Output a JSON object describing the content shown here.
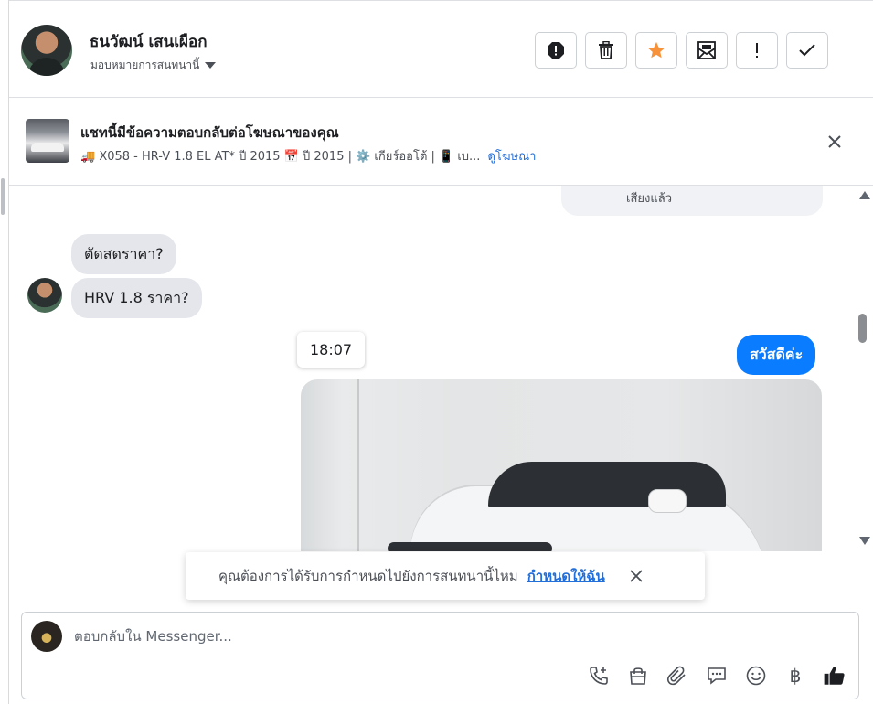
{
  "header": {
    "contact_name": "ธนวัฒน์ เสนเผือก",
    "assign_label": "มอบหมายการสนทนานี้",
    "actions": [
      {
        "name": "report-spam-button",
        "icon": "stop-alert-icon"
      },
      {
        "name": "delete-button",
        "icon": "trash-icon"
      },
      {
        "name": "star-button",
        "icon": "star-icon"
      },
      {
        "name": "mark-unread-button",
        "icon": "envelope-icon"
      },
      {
        "name": "follow-up-button",
        "icon": "exclamation-icon"
      },
      {
        "name": "mark-done-button",
        "icon": "check-icon"
      }
    ],
    "star_color": "#f7923b"
  },
  "ad_banner": {
    "title": "แชทนี้มีข้อความตอบกลับต่อโฆษณาของคุณ",
    "subtitle": "🚚 X058 - HR-V 1.8 EL AT* ปี 2015 📅 ปี 2015 | ⚙️ เกียร์ออโต้ | 📱 เบ...",
    "link_label": "ดูโฆษณา"
  },
  "messages": {
    "previous_snippet": "เสียงแล้ว",
    "incoming_1": "ตัดสดราคา?",
    "incoming_2": "HRV 1.8  ราคา?",
    "time_tooltip": "18:07",
    "outgoing_1": "สวัสดีค่ะ"
  },
  "toast": {
    "text": "คุณต้องการได้รับการกำหนดไปยังการสนทนานี้ไหม",
    "link_label": "กำหนดให้ฉัน"
  },
  "composer": {
    "placeholder": "ตอบกลับใน Messenger...",
    "currency_symbol": "฿",
    "tools": [
      "phone-plus-icon",
      "shopping-bag-icon",
      "paperclip-icon",
      "saved-reply-icon",
      "emoji-icon",
      "currency-icon",
      "thumbs-up-icon"
    ]
  },
  "colors": {
    "outgoing_bubble": "#0a7cff",
    "incoming_bubble": "#e4e6eb",
    "link": "#216fdb"
  }
}
